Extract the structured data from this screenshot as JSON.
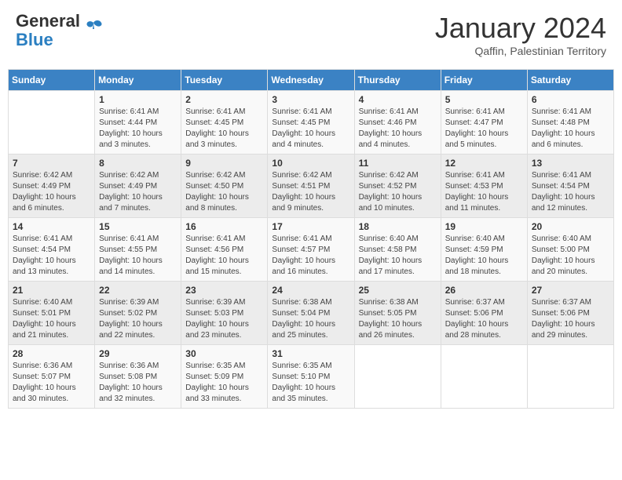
{
  "header": {
    "logo_general": "General",
    "logo_blue": "Blue",
    "month_title": "January 2024",
    "subtitle": "Qaffin, Palestinian Territory"
  },
  "columns": [
    "Sunday",
    "Monday",
    "Tuesday",
    "Wednesday",
    "Thursday",
    "Friday",
    "Saturday"
  ],
  "weeks": [
    [
      {
        "day": "",
        "info": ""
      },
      {
        "day": "1",
        "info": "Sunrise: 6:41 AM\nSunset: 4:44 PM\nDaylight: 10 hours\nand 3 minutes."
      },
      {
        "day": "2",
        "info": "Sunrise: 6:41 AM\nSunset: 4:45 PM\nDaylight: 10 hours\nand 3 minutes."
      },
      {
        "day": "3",
        "info": "Sunrise: 6:41 AM\nSunset: 4:45 PM\nDaylight: 10 hours\nand 4 minutes."
      },
      {
        "day": "4",
        "info": "Sunrise: 6:41 AM\nSunset: 4:46 PM\nDaylight: 10 hours\nand 4 minutes."
      },
      {
        "day": "5",
        "info": "Sunrise: 6:41 AM\nSunset: 4:47 PM\nDaylight: 10 hours\nand 5 minutes."
      },
      {
        "day": "6",
        "info": "Sunrise: 6:41 AM\nSunset: 4:48 PM\nDaylight: 10 hours\nand 6 minutes."
      }
    ],
    [
      {
        "day": "7",
        "info": "Sunrise: 6:42 AM\nSunset: 4:49 PM\nDaylight: 10 hours\nand 6 minutes."
      },
      {
        "day": "8",
        "info": "Sunrise: 6:42 AM\nSunset: 4:49 PM\nDaylight: 10 hours\nand 7 minutes."
      },
      {
        "day": "9",
        "info": "Sunrise: 6:42 AM\nSunset: 4:50 PM\nDaylight: 10 hours\nand 8 minutes."
      },
      {
        "day": "10",
        "info": "Sunrise: 6:42 AM\nSunset: 4:51 PM\nDaylight: 10 hours\nand 9 minutes."
      },
      {
        "day": "11",
        "info": "Sunrise: 6:42 AM\nSunset: 4:52 PM\nDaylight: 10 hours\nand 10 minutes."
      },
      {
        "day": "12",
        "info": "Sunrise: 6:41 AM\nSunset: 4:53 PM\nDaylight: 10 hours\nand 11 minutes."
      },
      {
        "day": "13",
        "info": "Sunrise: 6:41 AM\nSunset: 4:54 PM\nDaylight: 10 hours\nand 12 minutes."
      }
    ],
    [
      {
        "day": "14",
        "info": "Sunrise: 6:41 AM\nSunset: 4:54 PM\nDaylight: 10 hours\nand 13 minutes."
      },
      {
        "day": "15",
        "info": "Sunrise: 6:41 AM\nSunset: 4:55 PM\nDaylight: 10 hours\nand 14 minutes."
      },
      {
        "day": "16",
        "info": "Sunrise: 6:41 AM\nSunset: 4:56 PM\nDaylight: 10 hours\nand 15 minutes."
      },
      {
        "day": "17",
        "info": "Sunrise: 6:41 AM\nSunset: 4:57 PM\nDaylight: 10 hours\nand 16 minutes."
      },
      {
        "day": "18",
        "info": "Sunrise: 6:40 AM\nSunset: 4:58 PM\nDaylight: 10 hours\nand 17 minutes."
      },
      {
        "day": "19",
        "info": "Sunrise: 6:40 AM\nSunset: 4:59 PM\nDaylight: 10 hours\nand 18 minutes."
      },
      {
        "day": "20",
        "info": "Sunrise: 6:40 AM\nSunset: 5:00 PM\nDaylight: 10 hours\nand 20 minutes."
      }
    ],
    [
      {
        "day": "21",
        "info": "Sunrise: 6:40 AM\nSunset: 5:01 PM\nDaylight: 10 hours\nand 21 minutes."
      },
      {
        "day": "22",
        "info": "Sunrise: 6:39 AM\nSunset: 5:02 PM\nDaylight: 10 hours\nand 22 minutes."
      },
      {
        "day": "23",
        "info": "Sunrise: 6:39 AM\nSunset: 5:03 PM\nDaylight: 10 hours\nand 23 minutes."
      },
      {
        "day": "24",
        "info": "Sunrise: 6:38 AM\nSunset: 5:04 PM\nDaylight: 10 hours\nand 25 minutes."
      },
      {
        "day": "25",
        "info": "Sunrise: 6:38 AM\nSunset: 5:05 PM\nDaylight: 10 hours\nand 26 minutes."
      },
      {
        "day": "26",
        "info": "Sunrise: 6:37 AM\nSunset: 5:06 PM\nDaylight: 10 hours\nand 28 minutes."
      },
      {
        "day": "27",
        "info": "Sunrise: 6:37 AM\nSunset: 5:06 PM\nDaylight: 10 hours\nand 29 minutes."
      }
    ],
    [
      {
        "day": "28",
        "info": "Sunrise: 6:36 AM\nSunset: 5:07 PM\nDaylight: 10 hours\nand 30 minutes."
      },
      {
        "day": "29",
        "info": "Sunrise: 6:36 AM\nSunset: 5:08 PM\nDaylight: 10 hours\nand 32 minutes."
      },
      {
        "day": "30",
        "info": "Sunrise: 6:35 AM\nSunset: 5:09 PM\nDaylight: 10 hours\nand 33 minutes."
      },
      {
        "day": "31",
        "info": "Sunrise: 6:35 AM\nSunset: 5:10 PM\nDaylight: 10 hours\nand 35 minutes."
      },
      {
        "day": "",
        "info": ""
      },
      {
        "day": "",
        "info": ""
      },
      {
        "day": "",
        "info": ""
      }
    ]
  ]
}
